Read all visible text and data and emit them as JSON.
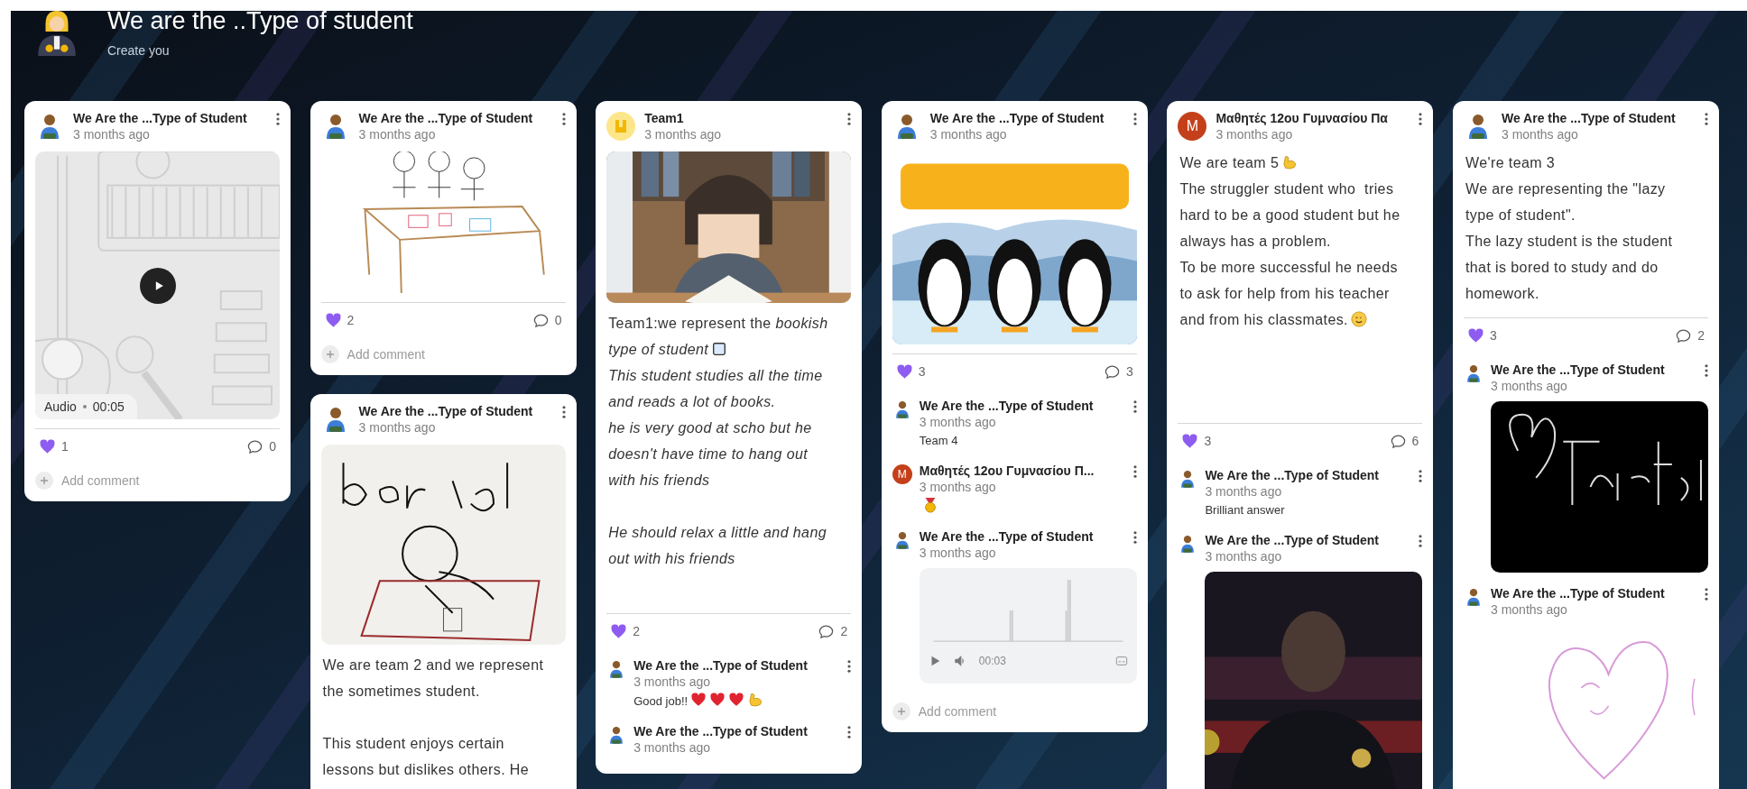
{
  "board": {
    "title": "We are the ..Type of student",
    "subtitle": "Create you"
  },
  "columns": [
    {
      "posts": [
        {
          "author": "We Are the ...Type of Student",
          "avatar": {
            "kind": "student"
          },
          "time": "3 months ago",
          "attachment": {
            "kind": "audio",
            "label": "Audio",
            "duration": "00:05"
          },
          "likes": "1",
          "comment_count": "0",
          "add_comment": "Add comment"
        }
      ]
    },
    {
      "posts": [
        {
          "author": "We Are the ...Type of Student",
          "avatar": {
            "kind": "student"
          },
          "time": "3 months ago",
          "attachment": {
            "kind": "picture"
          },
          "likes": "2",
          "comment_count": "0",
          "add_comment": "Add comment"
        },
        {
          "author": "We Are the ...Type of Student",
          "avatar": {
            "kind": "student"
          },
          "time": "3 months ago",
          "attachment": {
            "kind": "picture"
          },
          "body": [
            {
              "text": "We are team 2 and we represent the sometimes student.\n\nThis student enjoys certain lessons but dislikes others. He",
              "italic": false
            }
          ]
        }
      ]
    },
    {
      "posts": [
        {
          "author": "Team1",
          "avatar": {
            "kind": "team"
          },
          "time": "3 months ago",
          "attachment": {
            "kind": "picture"
          },
          "body": [
            {
              "text": "Team1:we represent the *bookish*",
              "italic": false
            },
            {
              "text": "type of student",
              "italic": true,
              "emoji": [
                {
                  "kind": "book"
                }
              ]
            },
            {
              "text": "This student studies all the time and reads a lot of books.\nhe is very good at scho but he doesn't have time to hang out with his friends\n\nHe should relax a little and hang out with his friends",
              "italic": true
            }
          ],
          "likes": "2",
          "comment_count": "2",
          "comments": [
            {
              "author": "We Are the ...Type of Student",
              "avatar": {
                "kind": "student"
              },
              "time": "3 months ago",
              "body": [
                {
                  "text": "Good job!!",
                  "emoji": [
                    {
                      "kind": "heart"
                    },
                    {
                      "kind": "heart"
                    },
                    {
                      "kind": "heart"
                    },
                    {
                      "kind": "muscle"
                    }
                  ]
                }
              ]
            },
            {
              "author": "We Are the ...Type of Student",
              "avatar": {
                "kind": "student"
              },
              "time": "3 months ago"
            }
          ]
        }
      ]
    },
    {
      "posts": [
        {
          "author": "We Are the ...Type of Student",
          "avatar": {
            "kind": "student"
          },
          "time": "3 months ago",
          "attachment": {
            "kind": "picture"
          },
          "likes": "3",
          "comment_count": "3",
          "comments": [
            {
              "author": "We Are the ...Type of Student",
              "avatar": {
                "kind": "student"
              },
              "time": "3 months ago",
              "body": [
                {
                  "text": "Team 4"
                }
              ]
            },
            {
              "author": "Μαθητές 12ου Γυμνασίου Π...",
              "avatar": {
                "kind": "letter",
                "letter": "M"
              },
              "time": "3 months ago",
              "body": [
                {
                  "emoji": [
                    {
                      "kind": "medal"
                    }
                  ]
                }
              ]
            },
            {
              "author": "We Are the ...Type of Student",
              "avatar": {
                "kind": "student"
              },
              "time": "3 months ago",
              "attachment": {
                "kind": "player",
                "time": "00:03"
              }
            }
          ],
          "add_comment": "Add comment"
        }
      ]
    },
    {
      "posts": [
        {
          "author": "Μαθητές 12ου Γυμνασίου Πα",
          "avatar": {
            "kind": "letter",
            "letter": "M"
          },
          "time": "3 months ago",
          "body": [
            {
              "text": "We are team 5",
              "italic": false,
              "emoji": [
                {
                  "kind": "muscle"
                }
              ]
            },
            {
              "text": "The struggler student who  tries hard to be a good student but he always has a problem.\nTo be more successful he needs to ask for help from his teacher",
              "italic": false
            },
            {
              "text": "and from his classmates.",
              "italic": false,
              "emoji": [
                {
                  "kind": "wink"
                }
              ]
            }
          ],
          "likes": "3",
          "comment_count": "6",
          "comments": [
            {
              "author": "We Are the ...Type of Student",
              "avatar": {
                "kind": "student"
              },
              "time": "3 months ago",
              "body": [
                {
                  "text": "Brilliant answer"
                }
              ]
            },
            {
              "author": "We Are the ...Type of Student",
              "avatar": {
                "kind": "student"
              },
              "time": "3 months ago",
              "attachment": {
                "kind": "picture"
              }
            }
          ]
        }
      ]
    },
    {
      "posts": [
        {
          "author": "We Are the ...Type of Student",
          "avatar": {
            "kind": "student"
          },
          "time": "3 months ago",
          "body": [
            {
              "text": "We're team 3\nWe are representing the \"lazy type of student\".\nThe lazy student is the student that is bored to study and do homework.",
              "italic": false
            }
          ],
          "likes": "3",
          "comment_count": "2",
          "comments": [
            {
              "author": "We Are the ...Type of Student",
              "avatar": {
                "kind": "student"
              },
              "time": "3 months ago",
              "attachment": {
                "kind": "picture"
              }
            },
            {
              "author": "We Are the ...Type of Student",
              "avatar": {
                "kind": "student"
              },
              "time": "3 months ago",
              "attachment": {
                "kind": "picture"
              }
            }
          ]
        }
      ]
    }
  ]
}
